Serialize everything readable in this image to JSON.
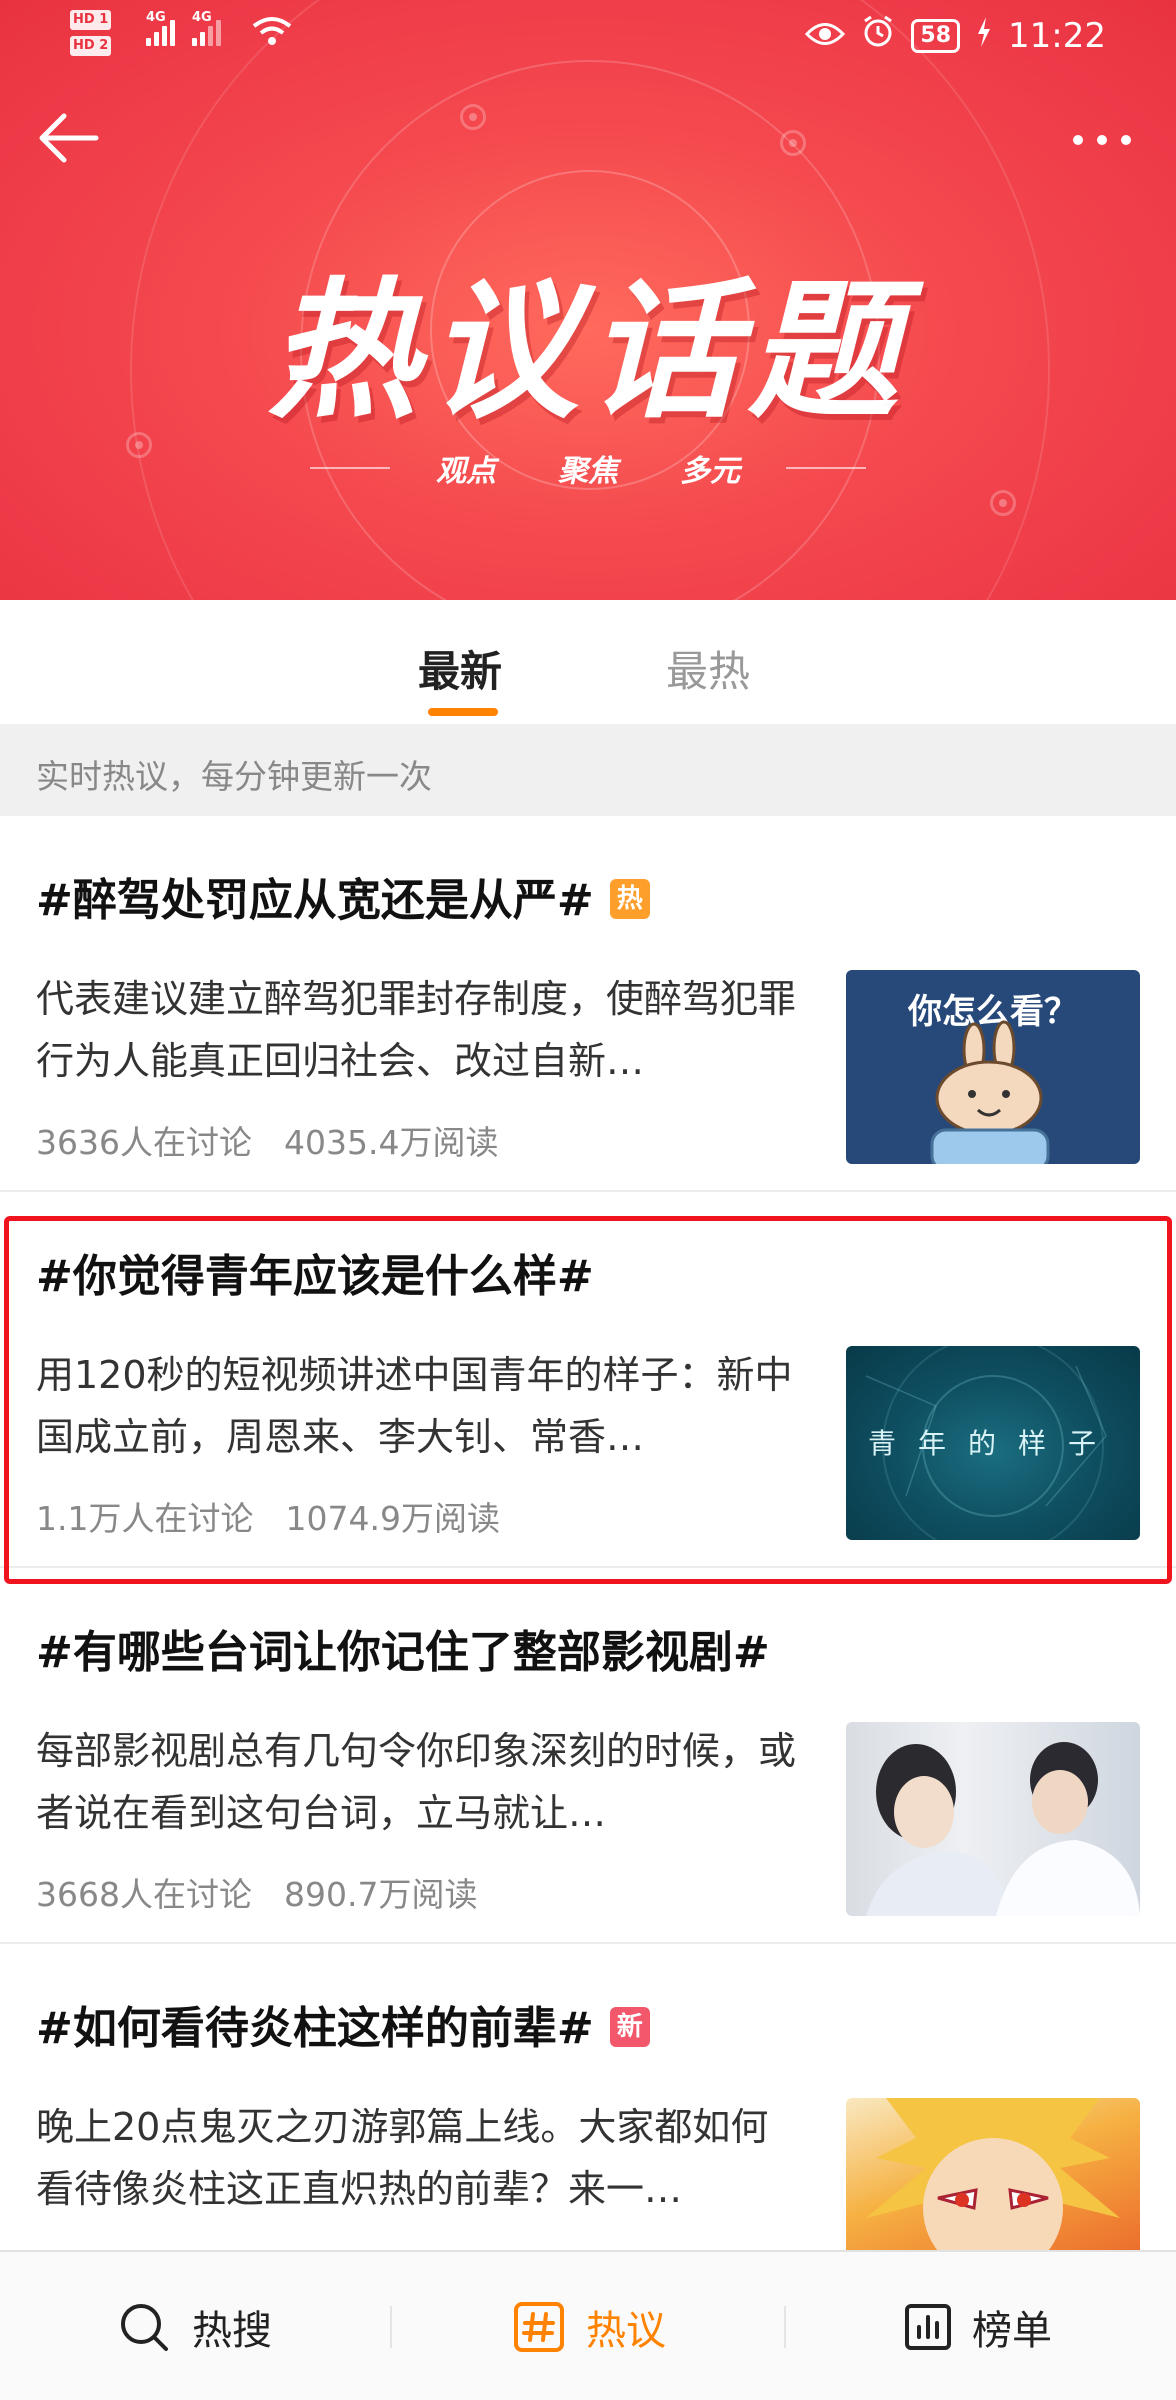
{
  "status_bar": {
    "hd1": "HD 1",
    "hd2": "HD 2",
    "net1": "4G",
    "net2": "4G",
    "battery": "58",
    "time": "11:22"
  },
  "hero": {
    "title": "热议话题",
    "subtitle_keywords": [
      "观点",
      "聚焦",
      "多元"
    ],
    "back_icon": "arrow-left-icon",
    "more_icon": "more-dots-icon"
  },
  "tabs": [
    {
      "label": "最新",
      "active": true
    },
    {
      "label": "最热",
      "active": false
    }
  ],
  "notice": "实时热议，每分钟更新一次",
  "topics": [
    {
      "title": "#醉驾处罚应从宽还是从严#",
      "badge": "热",
      "summary": "代表建议建立醉驾犯罪封存制度，使醉驾犯罪行为人能真正回归社会、改过自新…",
      "discuss": "3636人在讨论",
      "reads": "4035.4万阅读",
      "thumb_text": "你怎么看？"
    },
    {
      "title": "#你觉得青年应该是什么样#",
      "badge": "",
      "summary": "用120秒的短视频讲述中国青年的样子：新中国成立前，周恩来、李大钊、常香…",
      "discuss": "1.1万人在讨论",
      "reads": "1074.9万阅读",
      "thumb_text": "青年的样子"
    },
    {
      "title": "#有哪些台词让你记住了整部影视剧#",
      "badge": "",
      "summary": "每部影视剧总有几句令你印象深刻的时候，或者说在看到这句台词，立马就让…",
      "discuss": "3668人在讨论",
      "reads": "890.7万阅读",
      "thumb_text": ""
    },
    {
      "title": "#如何看待炎柱这样的前辈#",
      "badge": "新",
      "summary": "晚上20点鬼灭之刃游郭篇上线。大家都如何看待像炎柱这正直炽热的前辈？来一…",
      "discuss": "",
      "reads": "",
      "thumb_text": ""
    }
  ],
  "bottom_nav": [
    {
      "label": "热搜",
      "icon": "search-icon",
      "active": false
    },
    {
      "label": "热议",
      "icon": "hashtag-icon",
      "active": true
    },
    {
      "label": "榜单",
      "icon": "bar-chart-icon",
      "active": false
    }
  ],
  "colors": {
    "hero_red": "#ee3a48",
    "accent_orange": "#ff8200",
    "highlight_red": "#f0141f",
    "badge_hot": "#ff9f2b",
    "badge_new": "#f2576b"
  }
}
